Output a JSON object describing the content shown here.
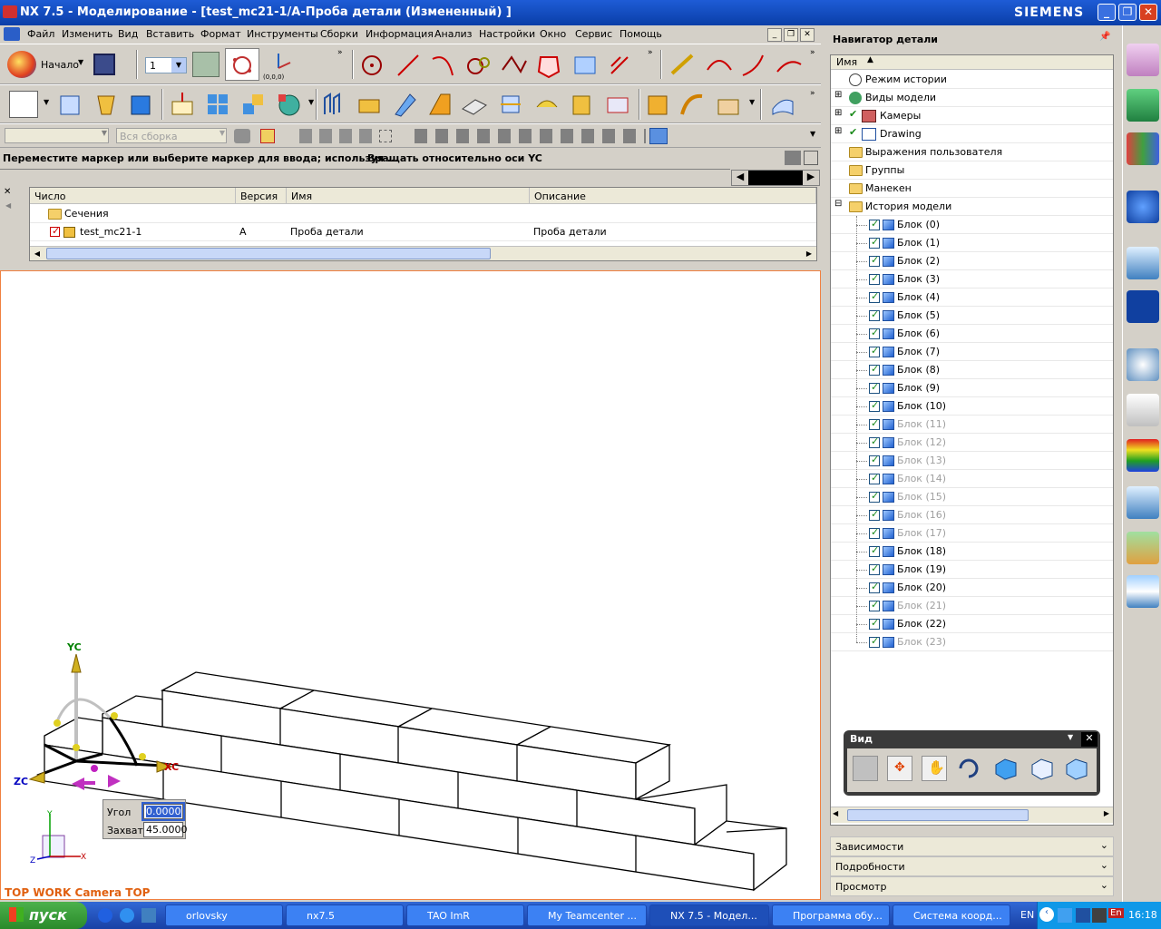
{
  "window": {
    "title": "NX 7.5 - Моделирование - [test_mc21-1/A-Проба детали (Измененный) ]",
    "brand": "SIEMENS",
    "minimize": "_",
    "maximize": "❐",
    "close": "✕"
  },
  "menu": {
    "items": [
      "Файл",
      "Изменить",
      "Вид",
      "Вставить",
      "Формат",
      "Инструменты",
      "Сборки",
      "Информация",
      "Анализ",
      "Настройки",
      "Окно",
      "Сервис",
      "Помощь"
    ]
  },
  "toolbar": {
    "start_label": "Начало",
    "layer_value": "1",
    "wcs_label": "(0,0,0)",
    "filter_value": "",
    "assembly_filter": "Вся сборка"
  },
  "cue": {
    "prompt": "Переместите маркер или выберите маркер для ввода; используя ...",
    "status": "Вращать относительно оси YC"
  },
  "assembly_nav": {
    "columns": [
      "Число",
      "Версия",
      "Имя",
      "Описание"
    ],
    "rows": [
      {
        "number": "Сечения",
        "version": "",
        "name": "",
        "description": ""
      },
      {
        "number": "test_mc21-1",
        "version": "A",
        "name": "Проба детали",
        "description": "Проба детали"
      }
    ]
  },
  "graphics": {
    "axis_yc": "YC",
    "axis_xc": "XC",
    "axis_zc": "ZC",
    "triad_x": "X",
    "triad_y": "Y",
    "triad_z": "Z",
    "angle_label": "Угол",
    "angle_value": "0.0000",
    "snap_label": "Захват",
    "snap_value": "45.0000",
    "view_label": "TOP WORK Camera TOP"
  },
  "part_nav": {
    "title": "Навигатор детали",
    "column_name": "Имя",
    "top_items": [
      "Режим истории",
      "Виды модели",
      "Камеры",
      "Drawing",
      "Выражения пользователя",
      "Группы",
      "Манекен",
      "История модели"
    ],
    "features": [
      {
        "label": "Блок (0)",
        "dim": false
      },
      {
        "label": "Блок (1)",
        "dim": false
      },
      {
        "label": "Блок (2)",
        "dim": false
      },
      {
        "label": "Блок (3)",
        "dim": false
      },
      {
        "label": "Блок (4)",
        "dim": false
      },
      {
        "label": "Блок (5)",
        "dim": false
      },
      {
        "label": "Блок (6)",
        "dim": false
      },
      {
        "label": "Блок (7)",
        "dim": false
      },
      {
        "label": "Блок (8)",
        "dim": false
      },
      {
        "label": "Блок (9)",
        "dim": false
      },
      {
        "label": "Блок (10)",
        "dim": false
      },
      {
        "label": "Блок (11)",
        "dim": true
      },
      {
        "label": "Блок (12)",
        "dim": true
      },
      {
        "label": "Блок (13)",
        "dim": true
      },
      {
        "label": "Блок (14)",
        "dim": true
      },
      {
        "label": "Блок (15)",
        "dim": true
      },
      {
        "label": "Блок (16)",
        "dim": true
      },
      {
        "label": "Блок (17)",
        "dim": true
      },
      {
        "label": "Блок (18)",
        "dim": false
      },
      {
        "label": "Блок (19)",
        "dim": false
      },
      {
        "label": "Блок (20)",
        "dim": false
      },
      {
        "label": "Блок (21)",
        "dim": true
      },
      {
        "label": "Блок (22)",
        "dim": false
      },
      {
        "label": "Блок (23)",
        "dim": true
      }
    ],
    "view_toolbar_title": "Вид",
    "sections": [
      "Зависимости",
      "Подробности",
      "Просмотр"
    ]
  },
  "taskbar": {
    "start": "пуск",
    "tasks": [
      {
        "label": "orlovsky",
        "active": false
      },
      {
        "label": "nx7.5",
        "active": false
      },
      {
        "label": "TAO ImR",
        "active": false
      },
      {
        "label": "My Teamcenter ...",
        "active": false
      },
      {
        "label": "NX 7.5 - Модел...",
        "active": true
      },
      {
        "label": "Программа обу...",
        "active": false
      },
      {
        "label": "Система коорд...",
        "active": false
      }
    ],
    "lang": "EN",
    "lang2": "En",
    "clock": "16:18"
  }
}
